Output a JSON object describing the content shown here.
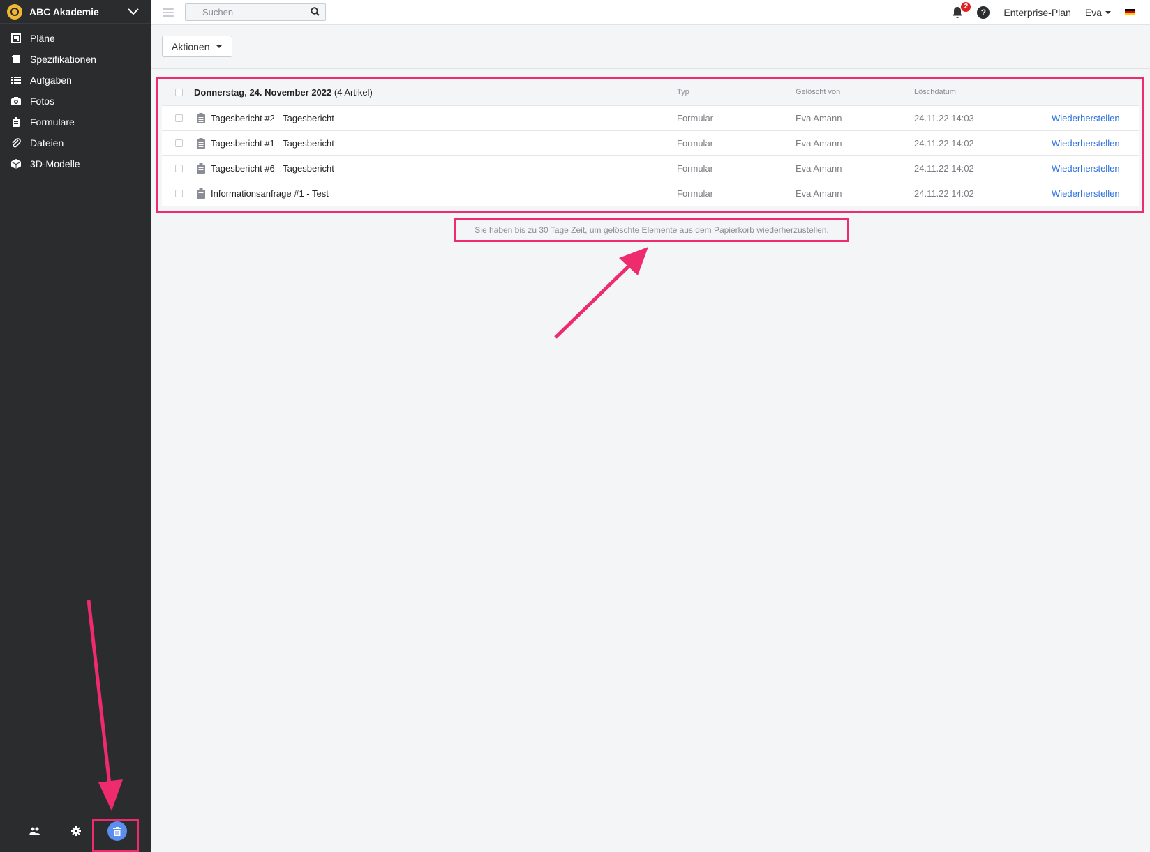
{
  "sidebar": {
    "org_name": "ABC Akademie",
    "items": [
      {
        "label": "Pläne",
        "icon": "plans-icon"
      },
      {
        "label": "Spezifikationen",
        "icon": "spec-book-icon"
      },
      {
        "label": "Aufgaben",
        "icon": "list-icon"
      },
      {
        "label": "Fotos",
        "icon": "camera-icon"
      },
      {
        "label": "Formulare",
        "icon": "clipboard-icon"
      },
      {
        "label": "Dateien",
        "icon": "paperclip-icon"
      },
      {
        "label": "3D-Modelle",
        "icon": "cube-icon"
      }
    ],
    "footer": {
      "users_icon": "users-icon",
      "settings_icon": "gear-icon",
      "trash_icon": "trash-icon"
    }
  },
  "topbar": {
    "search_placeholder": "Suchen",
    "notification_count": "2",
    "help_label": "?",
    "plan": "Enterprise-Plan",
    "user": "Eva",
    "language_flag": "german-flag-icon"
  },
  "actions": {
    "label": "Aktionen"
  },
  "table": {
    "group_title": "Donnerstag, 24. November 2022",
    "group_count": "(4 Artikel)",
    "headers": {
      "type": "Typ",
      "deleted_by": "Gelöscht von",
      "deleted_date": "Löschdatum"
    },
    "rows": [
      {
        "name": "Tagesbericht #2 - Tagesbericht",
        "type": "Formular",
        "deleted_by": "Eva Amann",
        "date": "24.11.22 14:03",
        "action": "Wiederherstellen"
      },
      {
        "name": "Tagesbericht #1 - Tagesbericht",
        "type": "Formular",
        "deleted_by": "Eva Amann",
        "date": "24.11.22 14:02",
        "action": "Wiederherstellen"
      },
      {
        "name": "Tagesbericht #6 - Tagesbericht",
        "type": "Formular",
        "deleted_by": "Eva Amann",
        "date": "24.11.22 14:02",
        "action": "Wiederherstellen"
      },
      {
        "name": "Informationsanfrage #1 - Test",
        "type": "Formular",
        "deleted_by": "Eva Amann",
        "date": "24.11.22 14:02",
        "action": "Wiederherstellen"
      }
    ]
  },
  "note": "Sie haben bis zu 30 Tage Zeit, um gelöschte Elemente aus dem Papierkorb wiederherzustellen.",
  "colors": {
    "highlight": "#ee2b6c",
    "link": "#2c72e0",
    "sidebar_bg": "#2b2c2e",
    "trash_active": "#5a8ef0"
  }
}
